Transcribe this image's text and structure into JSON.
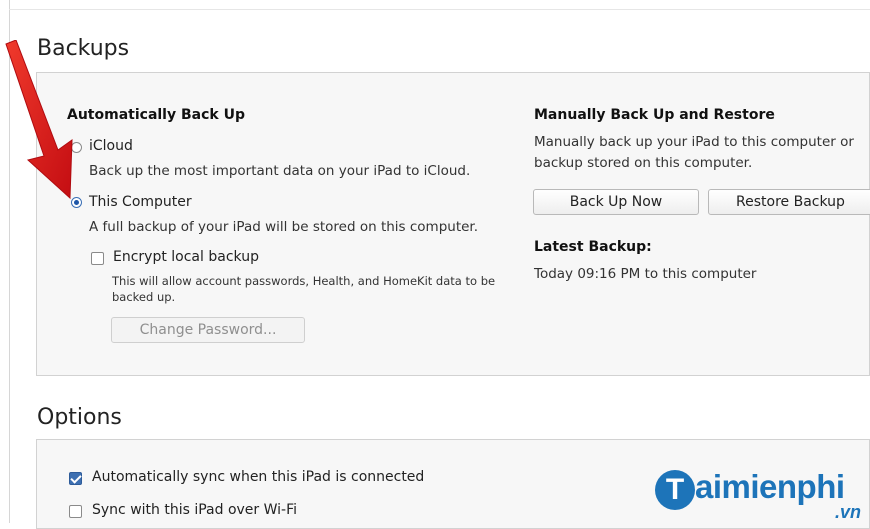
{
  "backups": {
    "title": "Backups",
    "auto": {
      "heading": "Automatically Back Up",
      "icloud": {
        "label": "iCloud",
        "description": "Back up the most important data on your iPad to iCloud.",
        "selected": false
      },
      "this_computer": {
        "label": "This Computer",
        "description": "A full backup of your iPad will be stored on this computer.",
        "selected": true
      },
      "encrypt": {
        "label": "Encrypt local backup",
        "checked": false,
        "note_line1": "This will allow account passwords, Health, and HomeKit data to be",
        "note_line2": "backed up."
      },
      "change_password_label": "Change Password..."
    },
    "manual": {
      "heading": "Manually Back Up and Restore",
      "description_line1": "Manually back up your iPad to this computer or",
      "description_line2": "backup stored on this computer.",
      "back_up_now_label": "Back Up Now",
      "restore_backup_label": "Restore Backup"
    },
    "latest": {
      "heading": "Latest Backup:",
      "value": "Today 09:16 PM to this computer"
    }
  },
  "options": {
    "title": "Options",
    "auto_sync": {
      "label": "Automatically sync when this iPad is connected",
      "checked": true
    },
    "wifi_sync": {
      "label": "Sync with this iPad over Wi-Fi",
      "checked": false
    }
  },
  "watermark": {
    "badge": "T",
    "text": "aimienphi",
    "suffix": ".vn"
  },
  "colors": {
    "arrow": "#e8141b",
    "accent": "#1f57a8",
    "watermark": "#1d74b9"
  }
}
